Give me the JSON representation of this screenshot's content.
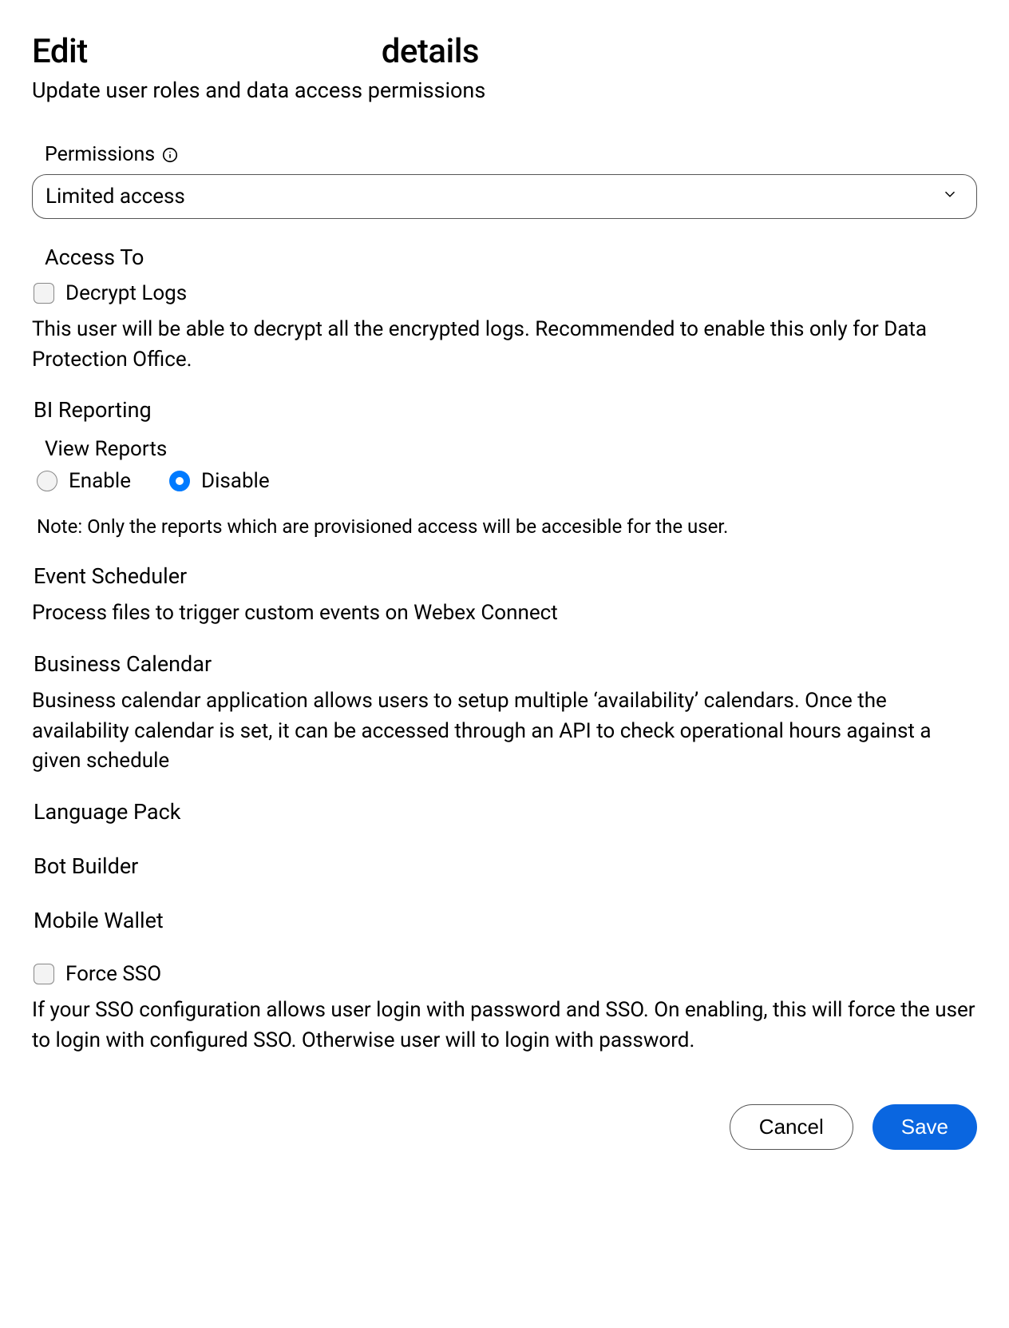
{
  "page": {
    "title_prefix": "Edit",
    "title_suffix": "details",
    "subtitle": "Update user roles and data access permissions"
  },
  "permissions": {
    "label": "Permissions",
    "selected": "Limited access"
  },
  "access": {
    "heading": "Access To",
    "decrypt_logs_label": "Decrypt Logs",
    "decrypt_logs_checked": false,
    "decrypt_logs_description": "This user will be able to decrypt all the encrypted logs. Recommended to enable this only for Data Protection Office."
  },
  "bi": {
    "heading": "BI Reporting",
    "view_reports_label": "View Reports",
    "enable_label": "Enable",
    "disable_label": "Disable",
    "selected": "disable",
    "note": "Note: Only the reports which are provisioned access will be accesible for the user."
  },
  "event_scheduler": {
    "heading": "Event Scheduler",
    "description": "Process files to trigger custom events on Webex Connect"
  },
  "business_calendar": {
    "heading": "Business Calendar",
    "description": "Business calendar application allows users to setup multiple ‘availability’ calendars. Once the availability calendar is set, it can be accessed through an API to check operational hours against a given schedule"
  },
  "language_pack": {
    "heading": "Language Pack"
  },
  "bot_builder": {
    "heading": "Bot Builder"
  },
  "mobile_wallet": {
    "heading": "Mobile Wallet"
  },
  "force_sso": {
    "label": "Force SSO",
    "checked": false,
    "description": "If your SSO configuration allows user login with password and SSO. On enabling, this will force the user to login with configured SSO. Otherwise user will to login with password."
  },
  "buttons": {
    "cancel": "Cancel",
    "save": "Save"
  }
}
